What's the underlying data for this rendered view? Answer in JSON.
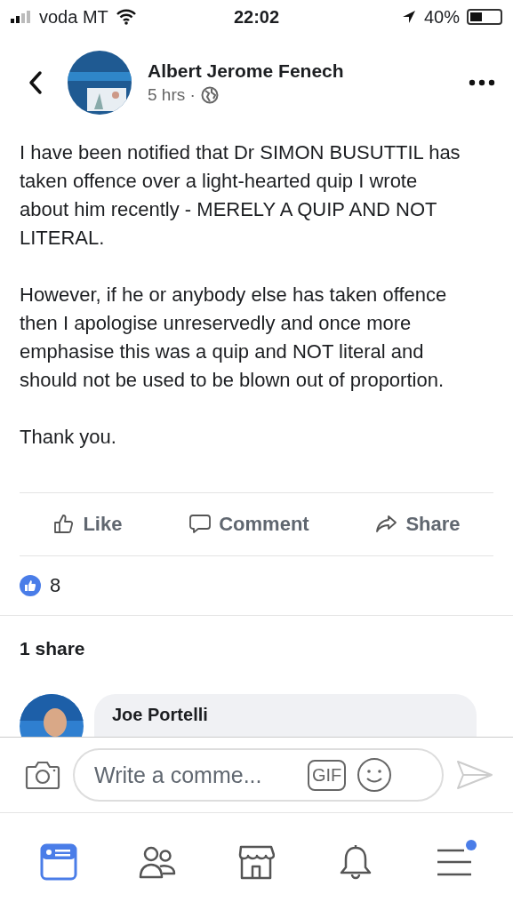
{
  "status_bar": {
    "carrier": "voda MT",
    "time": "22:02",
    "battery": "40%"
  },
  "post": {
    "author": "Albert Jerome Fenech",
    "time": "5 hrs ·",
    "paragraphs": [
      "I have been notified that Dr SIMON BUSUTTIL has taken offence over a light-hearted quip I wrote about him recently - MERELY A QUIP AND NOT LITERAL.",
      "However, if he or anybody else has taken offence then I apologise unreservedly and once more emphasise this was a quip and NOT literal and should not be used to be blown out of proportion.",
      "Thank you."
    ]
  },
  "actions": [
    {
      "kind": "like",
      "label": "Like"
    },
    {
      "kind": "comment",
      "label": "Comment"
    },
    {
      "kind": "share",
      "label": "Share"
    }
  ],
  "reactions": {
    "count": "8"
  },
  "shares": "1 share",
  "comment": {
    "author": "Joe Portelli"
  },
  "composer": {
    "placeholder": "Write a comme...",
    "gif": "GIF"
  },
  "tab_bar": [
    {
      "kind": "feed",
      "selected": true,
      "dot": false
    },
    {
      "kind": "friends",
      "selected": false,
      "dot": false
    },
    {
      "kind": "market",
      "selected": false,
      "dot": false
    },
    {
      "kind": "bell",
      "selected": false,
      "dot": false
    },
    {
      "kind": "menu",
      "selected": false,
      "dot": true
    }
  ]
}
